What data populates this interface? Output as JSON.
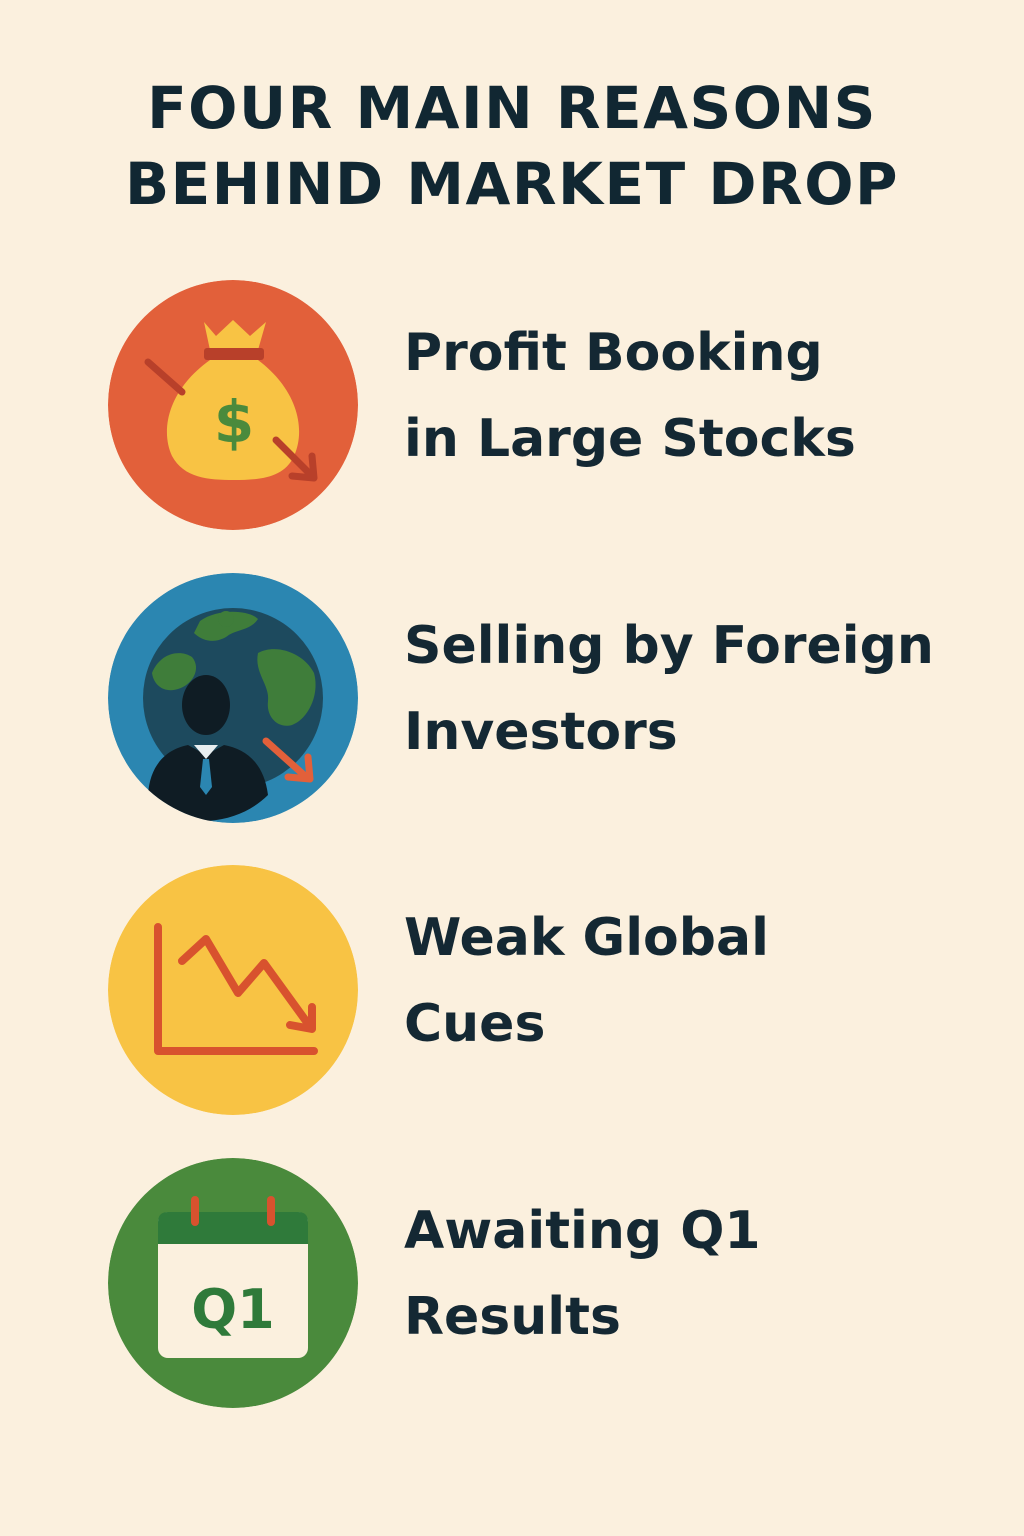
{
  "title": {
    "line1": "FOUR MAIN REASONS",
    "line2": "BEHIND MARKET DROP"
  },
  "reasons": [
    {
      "line1": "Profit Booking",
      "line2": "in Large Stocks",
      "icon": "money-bag-icon",
      "color": "#e2603a"
    },
    {
      "line1": "Selling by Foreign",
      "line2": "Investors",
      "icon": "globe-investor-icon",
      "color": "#2b86b1"
    },
    {
      "line1": "Weak Global",
      "line2": "Cues",
      "icon": "falling-chart-icon",
      "color": "#f8c344"
    },
    {
      "line1": "Awaiting Q1",
      "line2": "Results",
      "icon": "calendar-icon",
      "color": "#4a8a3c",
      "calendar_text": "Q1"
    }
  ]
}
